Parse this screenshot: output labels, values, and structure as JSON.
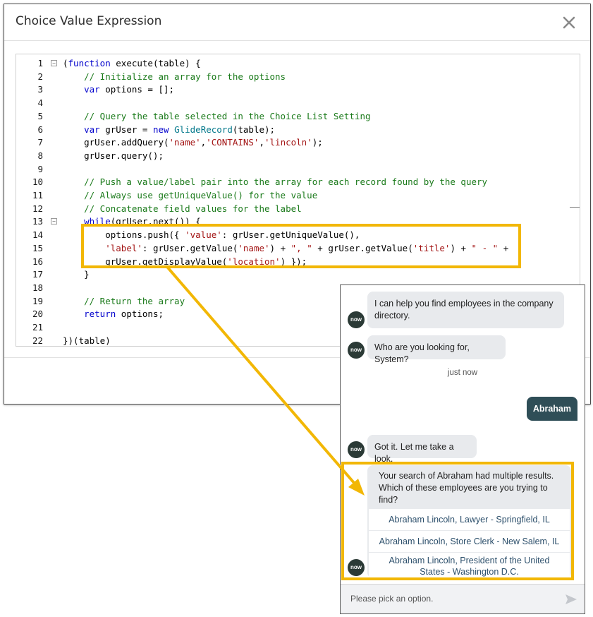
{
  "modal": {
    "title": "Choice Value Expression",
    "close_label": "×"
  },
  "editor": {
    "lines": [
      {
        "n": "1",
        "fold": "−",
        "parts": [
          [
            "p",
            "("
          ],
          [
            "kw",
            "function"
          ],
          [
            "p",
            " execute(table) {"
          ]
        ]
      },
      {
        "n": "2",
        "parts": [
          [
            "p",
            "    "
          ],
          [
            "cm",
            "// Initialize an array for the options"
          ]
        ]
      },
      {
        "n": "3",
        "parts": [
          [
            "p",
            "    "
          ],
          [
            "kw",
            "var"
          ],
          [
            "p",
            " options = [];"
          ]
        ]
      },
      {
        "n": "4",
        "parts": []
      },
      {
        "n": "5",
        "parts": [
          [
            "p",
            "    "
          ],
          [
            "cm",
            "// Query the table selected in the Choice List Setting"
          ]
        ]
      },
      {
        "n": "6",
        "parts": [
          [
            "p",
            "    "
          ],
          [
            "kw",
            "var"
          ],
          [
            "p",
            " grUser = "
          ],
          [
            "kw",
            "new"
          ],
          [
            "p",
            " "
          ],
          [
            "fn",
            "GlideRecord"
          ],
          [
            "p",
            "(table);"
          ]
        ]
      },
      {
        "n": "7",
        "parts": [
          [
            "p",
            "    grUser.addQuery("
          ],
          [
            "st",
            "'name'"
          ],
          [
            "p",
            ","
          ],
          [
            "st",
            "'CONTAINS'"
          ],
          [
            "p",
            ","
          ],
          [
            "st",
            "'lincoln'"
          ],
          [
            "p",
            ");"
          ]
        ]
      },
      {
        "n": "8",
        "parts": [
          [
            "p",
            "    grUser.query();"
          ]
        ]
      },
      {
        "n": "9",
        "parts": []
      },
      {
        "n": "10",
        "parts": [
          [
            "p",
            "    "
          ],
          [
            "cm",
            "// Push a value/label pair into the array for each record found by the query"
          ]
        ]
      },
      {
        "n": "11",
        "parts": [
          [
            "p",
            "    "
          ],
          [
            "cm",
            "// Always use getUniqueValue() for the value"
          ]
        ]
      },
      {
        "n": "12",
        "parts": [
          [
            "p",
            "    "
          ],
          [
            "cm",
            "// Concatenate field values for the label"
          ]
        ]
      },
      {
        "n": "13",
        "fold": "−",
        "parts": [
          [
            "p",
            "    "
          ],
          [
            "kw",
            "while"
          ],
          [
            "p",
            "(grUser.next()) {"
          ]
        ]
      },
      {
        "n": "14",
        "parts": [
          [
            "p",
            "        options.push({ "
          ],
          [
            "st",
            "'value'"
          ],
          [
            "p",
            ": grUser.getUniqueValue(),"
          ]
        ]
      },
      {
        "n": "15",
        "parts": [
          [
            "p",
            "        "
          ],
          [
            "st",
            "'label'"
          ],
          [
            "p",
            ": grUser.getValue("
          ],
          [
            "st",
            "'name'"
          ],
          [
            "p",
            ") + "
          ],
          [
            "st",
            "\", \""
          ],
          [
            "p",
            " + grUser.getValue("
          ],
          [
            "st",
            "'title'"
          ],
          [
            "p",
            ") + "
          ],
          [
            "st",
            "\" - \""
          ],
          [
            "p",
            " +"
          ]
        ]
      },
      {
        "n": "16",
        "parts": [
          [
            "p",
            "        grUser.getDisplayValue("
          ],
          [
            "st",
            "'location'"
          ],
          [
            "p",
            ") });"
          ]
        ]
      },
      {
        "n": "17",
        "parts": [
          [
            "p",
            "    }"
          ]
        ]
      },
      {
        "n": "18",
        "parts": []
      },
      {
        "n": "19",
        "parts": [
          [
            "p",
            "    "
          ],
          [
            "cm",
            "// Return the array"
          ]
        ]
      },
      {
        "n": "20",
        "parts": [
          [
            "p",
            "    "
          ],
          [
            "kw",
            "return"
          ],
          [
            "p",
            " options;"
          ]
        ]
      },
      {
        "n": "21",
        "parts": []
      },
      {
        "n": "22",
        "parts": [
          [
            "p",
            "})(table)"
          ]
        ]
      }
    ]
  },
  "chat": {
    "avatar_label": "now",
    "msg1": "I can help you find employees in the company directory.",
    "msg2": "Who are you looking for, System?",
    "timestamp": "just now",
    "user_msg": "Abraham",
    "msg3": "Got it. Let me take a look.",
    "msg4": "Your search of Abraham had multiple results. Which of these employees are you trying to find?",
    "options": [
      "Abraham Lincoln, Lawyer - Springfield, IL",
      "Abraham Lincoln, Store Clerk - New Salem, IL",
      "Abraham Lincoln, President of the United States - Washington D.C."
    ],
    "input_placeholder": "Please pick an option."
  },
  "colors": {
    "highlight": "#f2b705",
    "user_bubble": "#2f4e57",
    "bot_bubble": "#e8eaed",
    "avatar": "#2b3a36"
  }
}
